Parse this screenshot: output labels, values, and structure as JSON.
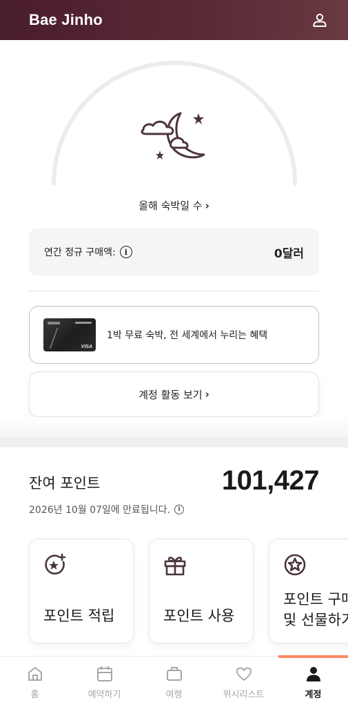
{
  "header": {
    "user_name": "Bae Jinho",
    "profile_icon": "person-outline-icon"
  },
  "nights": {
    "link_label": "올해 숙박일 수",
    "chevron": "›",
    "illustration_icon": "moon-stars-cloud-icon"
  },
  "annual_spend": {
    "label": "연간 정규 구매액:",
    "info_glyph": "i",
    "value": "0달러"
  },
  "card_promo": {
    "text": "1박 무료 숙박, 전 세계에서 누리는 혜택",
    "card_brand": "VISA"
  },
  "activity_button": {
    "label": "계정 활동 보기",
    "chevron": "›"
  },
  "points": {
    "title": "잔여 포인트",
    "value": "101,427",
    "expiry": "2026년 10월 07일에 만료됩니다.",
    "info_glyph": "i"
  },
  "tiles": [
    {
      "label": "포인트 적립",
      "icon": "star-plus-icon"
    },
    {
      "label": "포인트 사용",
      "icon": "gift-icon"
    },
    {
      "label_line1": "포인트 구매",
      "label_line2": "및 선물하기",
      "icon": "star-circle-icon"
    }
  ],
  "bottom_nav": [
    {
      "label": "홈",
      "icon": "home-icon"
    },
    {
      "label": "예약하기",
      "icon": "calendar-icon"
    },
    {
      "label": "여행",
      "icon": "briefcase-icon"
    },
    {
      "label": "위시리스트",
      "icon": "heart-icon"
    },
    {
      "label": "계정",
      "icon": "person-filled-icon",
      "active": true
    }
  ],
  "colors": {
    "header_bg": "#4a1d2c",
    "accent_active": "#ff8a66",
    "icon_dark": "#4a3438"
  }
}
